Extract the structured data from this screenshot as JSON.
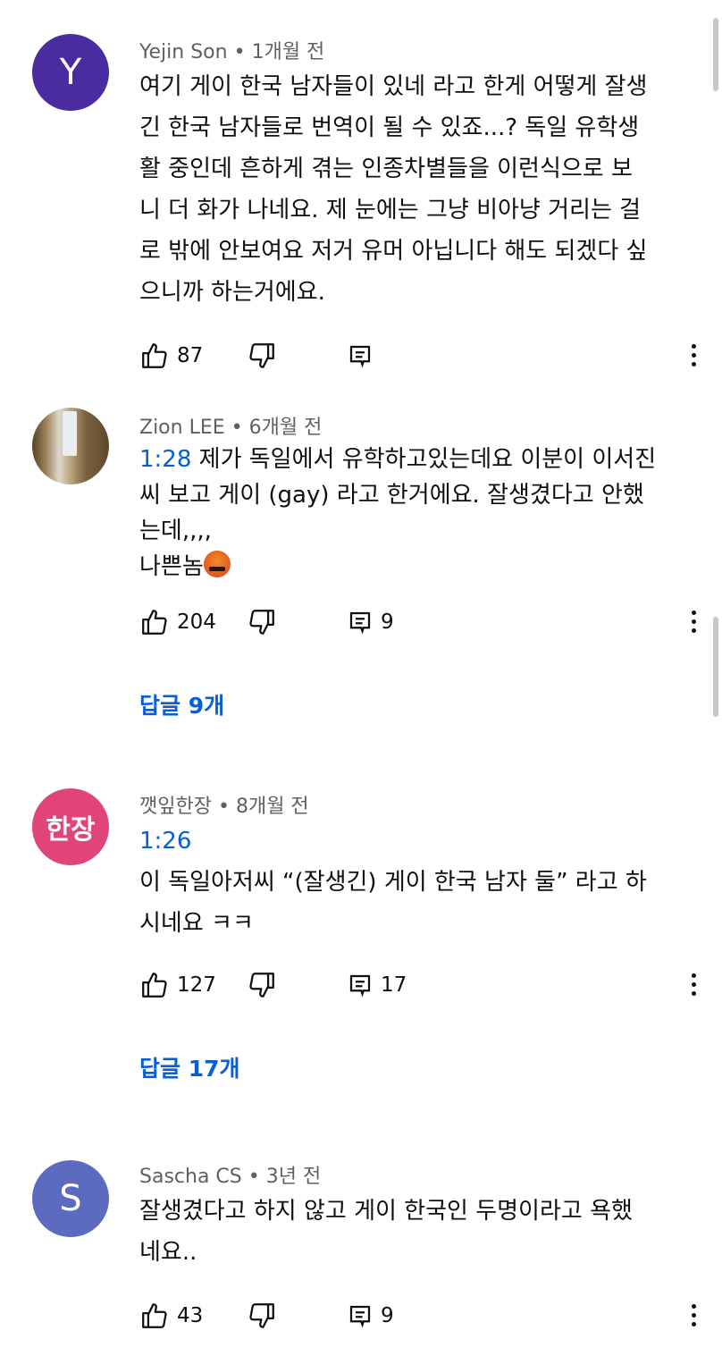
{
  "colors": {
    "link": "#065fd4",
    "meta": "#606060"
  },
  "comments": [
    {
      "avatar_text": "Y",
      "avatar_color": "#4b2ca0",
      "author": "Yejin Son",
      "time": "1개월 전",
      "lines": [
        "여기 게이 한국 남자들이 있네 라고 한게 어떻게 잘생",
        "긴 한국 남자들로 번역이 될 수 있죠...? 독일 유학생",
        "활 중인데 흔하게 겪는 인종차별들을 이런식으로 보",
        "니 더 화가 나네요. 제 눈에는 그냥 비아냥 거리는 걸",
        "로 밖에 안보여요 저거 유머 아닙니다 해도 되겠다 싶",
        "으니까 하는거에요."
      ],
      "likes": "87",
      "replies_count": ""
    },
    {
      "avatar_icon": "profile-photo",
      "author": "Zion LEE",
      "time": "6개월 전",
      "timestamp": "1:28",
      "line1_rest": " 제가 독일에서 유학하고있는데요 이분이 이서진",
      "lines": [
        "씨 보고 게이 (gay) 라고 한거에요. 잘생겼다고 안했",
        "는데,,,,"
      ],
      "last_line": "나쁜놈",
      "emoji": "angry-cursing-face-emoji",
      "likes": "204",
      "replies_count": "9",
      "view_replies": "답글 9개"
    },
    {
      "avatar_text": "한장",
      "avatar_color": "#e0447a",
      "author": "깻잎한장",
      "time": "8개월 전",
      "timestamp": "1:26",
      "lines": [
        "이 독일아저씨 “(잘생긴) 게이 한국 남자 둘” 라고 하",
        "시네요 ㅋㅋ"
      ],
      "likes": "127",
      "replies_count": "17",
      "view_replies": "답글 17개"
    },
    {
      "avatar_text": "S",
      "avatar_color": "#5c6bc0",
      "author": "Sascha CS",
      "time": "3년 전",
      "lines": [
        "잘생겼다고 하지 않고 게이 한국인 두명이라고 욕했",
        "네요.."
      ],
      "likes": "43",
      "replies_count": "9"
    }
  ],
  "icons": {
    "like": "thumb-up-icon",
    "dislike": "thumb-down-icon",
    "reply": "reply-icon",
    "more": "more-vert-icon"
  }
}
